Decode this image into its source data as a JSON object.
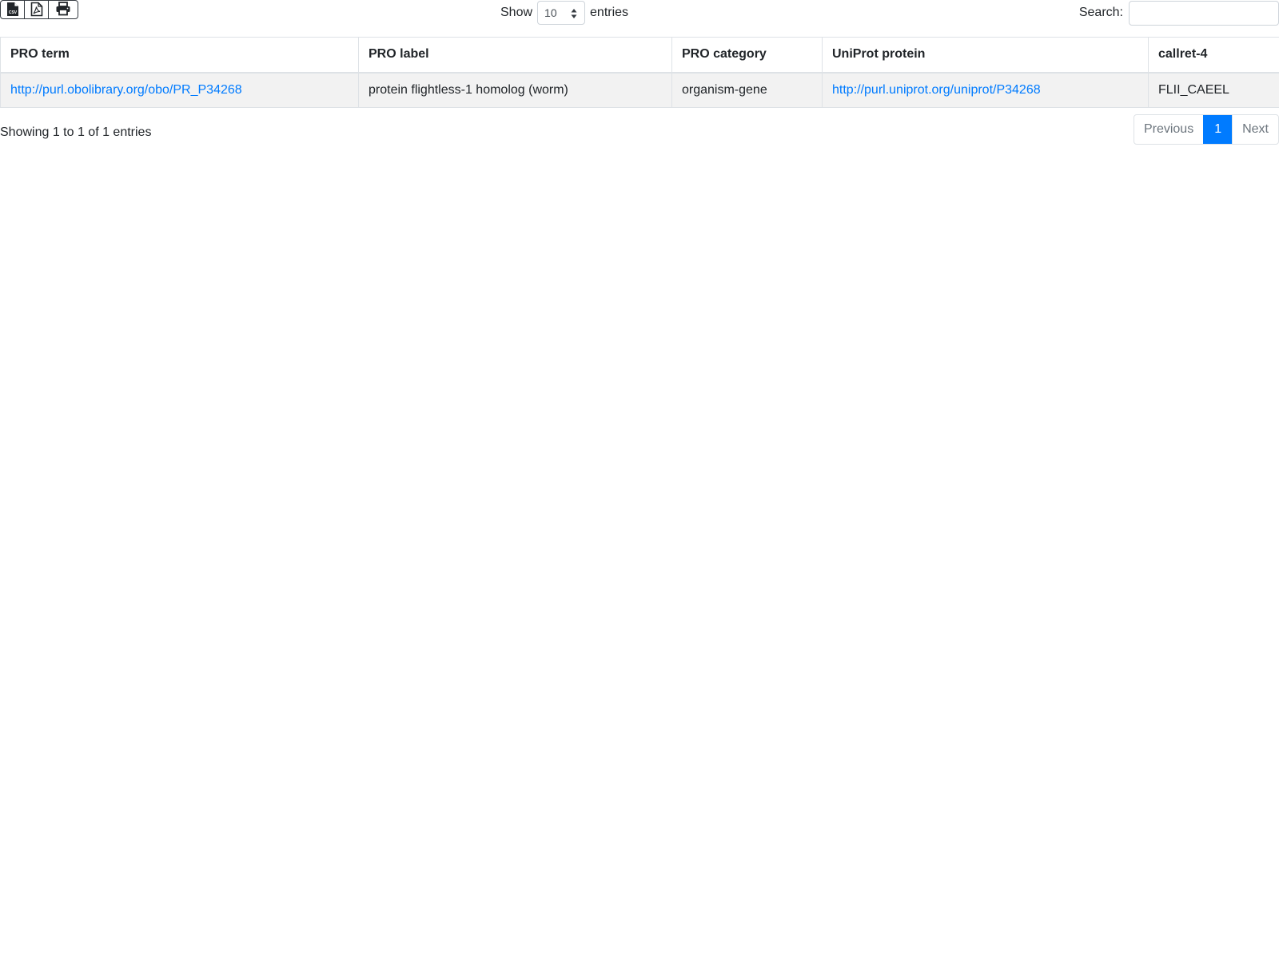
{
  "toolbar": {
    "buttons": [
      {
        "icon": "csv-file-icon",
        "label": "CSV"
      },
      {
        "icon": "pdf-file-icon"
      },
      {
        "icon": "print-icon"
      }
    ]
  },
  "length": {
    "prefix": "Show",
    "value": "10",
    "suffix": "entries"
  },
  "search": {
    "label": "Search:",
    "value": ""
  },
  "table": {
    "columns": [
      "PRO term",
      "PRO label",
      "PRO category",
      "UniProt protein",
      "callret-4"
    ],
    "rows": [
      {
        "pro_term": "http://purl.obolibrary.org/obo/PR_P34268",
        "pro_label": "protein flightless-1 homolog (worm)",
        "pro_category": "organism-gene",
        "uniprot_protein": "http://purl.uniprot.org/uniprot/P34268",
        "callret": "FLII_CAEEL"
      }
    ]
  },
  "info": "Showing 1 to 1 of 1 entries",
  "pagination": {
    "previous": "Previous",
    "current": "1",
    "next": "Next"
  },
  "colors": {
    "link": "#007bff",
    "active_page": "#007bff",
    "row_stripe": "#f2f2f2"
  }
}
